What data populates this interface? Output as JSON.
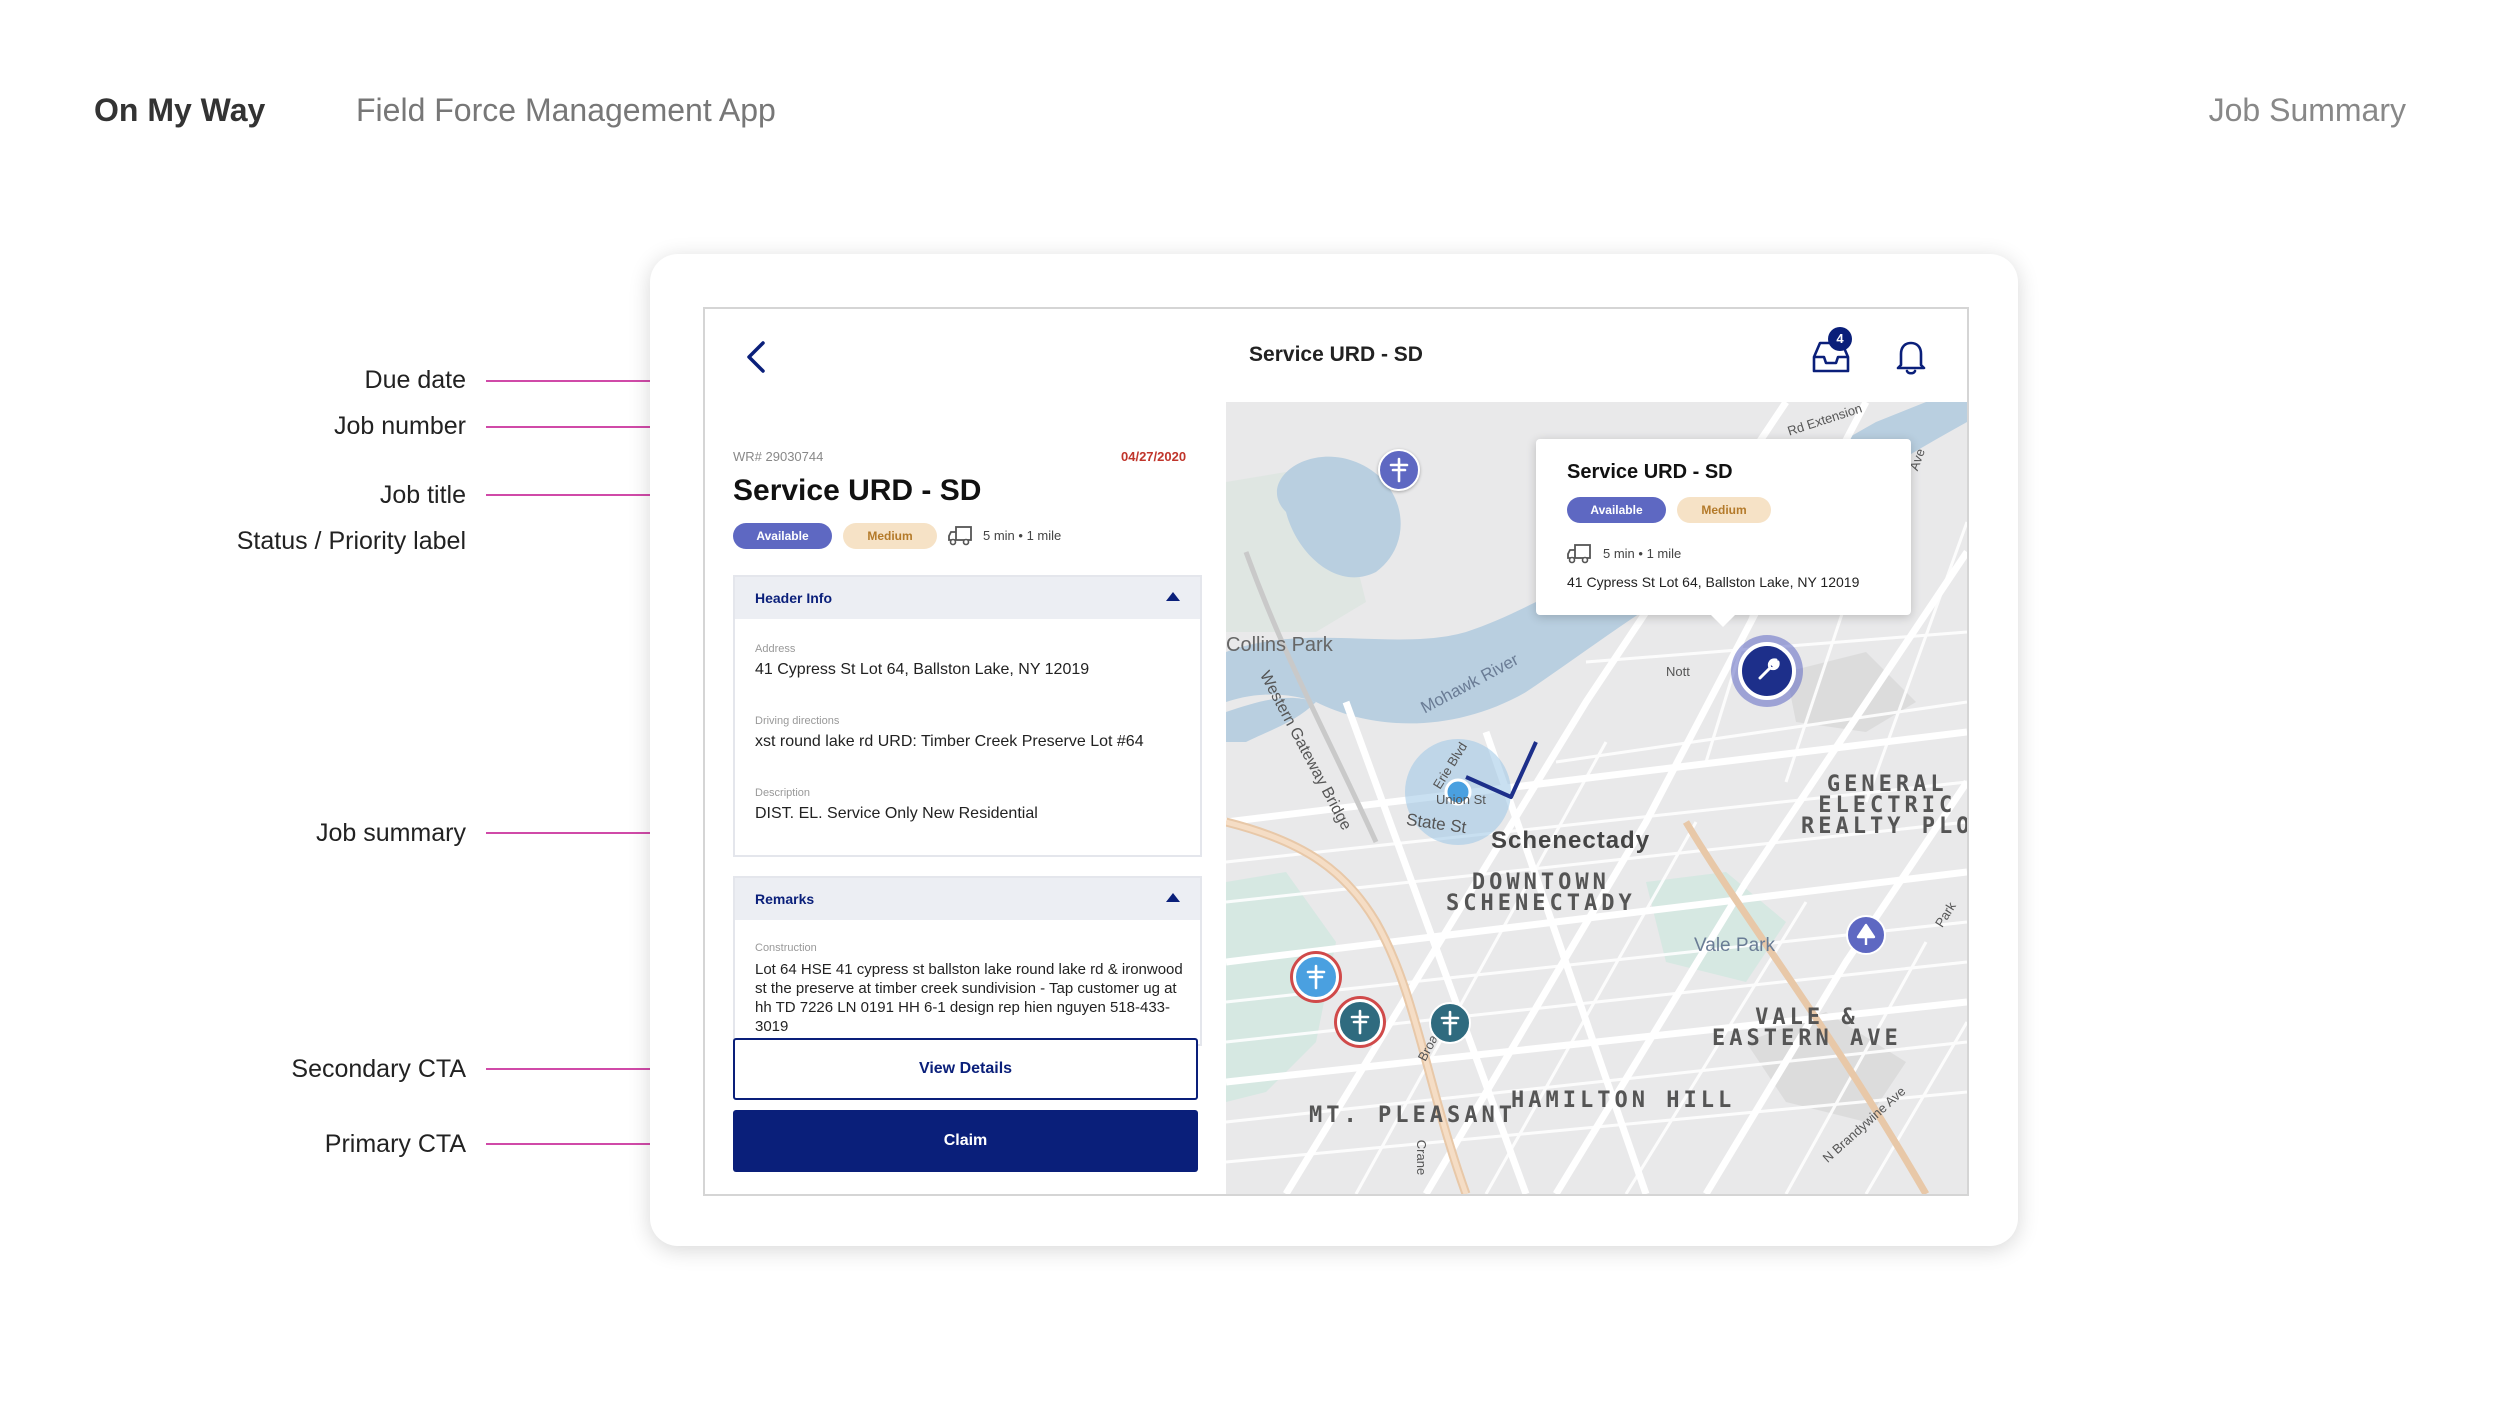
{
  "presentation": {
    "brand": "On My Way",
    "subtitle": "Field Force Management App",
    "section": "Job Summary"
  },
  "annotations": {
    "due_date": "Due date",
    "job_number": "Job number",
    "job_title": "Job title",
    "status_priority": "Status / Priority label",
    "job_summary": "Job summary",
    "secondary_cta": "Secondary CTA",
    "primary_cta": "Primary CTA"
  },
  "topbar": {
    "title": "Service URD - SD",
    "inbox_count": "4"
  },
  "job": {
    "work_request": "WR# 29030744",
    "due_date": "04/27/2020",
    "title": "Service URD - SD",
    "status": "Available",
    "priority": "Medium",
    "eta": "5 min • 1 mile"
  },
  "header_info": {
    "title": "Header Info",
    "address_label": "Address",
    "address": "41 Cypress St Lot 64, Ballston Lake, NY 12019",
    "directions_label": "Driving directions",
    "directions": "xst round lake rd URD: Timber Creek Preserve Lot #64",
    "description_label": "Description",
    "description": "DIST. EL. Service Only New Residential"
  },
  "remarks": {
    "title": "Remarks",
    "construction_label": "Construction",
    "construction": "Lot 64 HSE 41 cypress st ballston lake round lake rd & ironwood st the preserve at timber creek sundivision - Tap customer ug at hh TD 7226 LN 0191 HH 6-1 design rep hien nguyen 518-433-3019"
  },
  "actions": {
    "secondary": "View Details",
    "primary": "Claim"
  },
  "map": {
    "labels": {
      "collins_park": "Collins Park",
      "mohawk_river": "Mohawk River",
      "western_gateway": "Western Gateway Bridge",
      "state_st": "State St",
      "schenectady": "Schenectady",
      "downtown": "DOWNTOWN\nSCHENECTADY",
      "general_electric": "GENERAL\nELECTRIC\nREALTY PLO",
      "vale_park": "Vale Park",
      "vale_eastern": "VALE &\nEASTERN AVE",
      "hamilton_hill": "HAMILTON HILL",
      "mt_pleasant": "MT. PLEASANT",
      "erie_blvd": "Erie Blvd",
      "union_st": "Union St",
      "rd_extension": "Rd Extension",
      "broadway": "Broadway",
      "crane": "Crane",
      "park": "Park",
      "n_brandywine": "N Brandywine Ave",
      "nott": "Nott",
      "ave": "Ave"
    },
    "popup": {
      "title": "Service URD - SD",
      "status": "Available",
      "priority": "Medium",
      "eta": "5 min • 1 mile",
      "address": "41 Cypress St Lot 64, Ballston Lake, NY 12019"
    }
  },
  "colors": {
    "primary": "#0a1f7a",
    "annotation": "#d04aa8",
    "available": "#5e68c2",
    "medium_bg": "#f6e2c6",
    "due": "#c0352b"
  }
}
